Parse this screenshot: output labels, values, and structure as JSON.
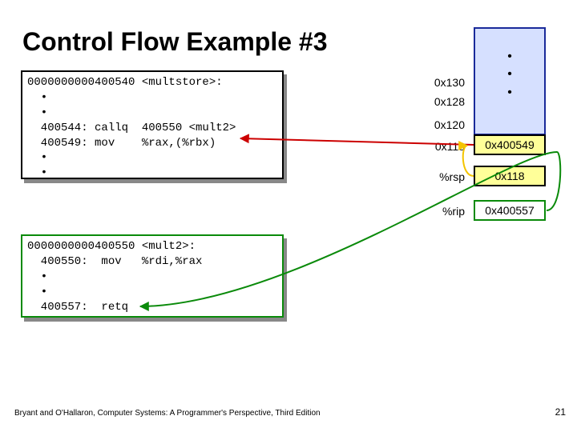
{
  "title": "Control Flow Example #3",
  "code1": "0000000000400540 <multstore>:\n  •\n  •\n  400544: callq  400550 <mult2>\n  400549: mov    %rax,(%rbx)\n  •\n  •",
  "code2": "0000000000400550 <mult2>:\n  400550:  mov   %rdi,%rax\n  •\n  •\n  400557:  retq",
  "stack_dots": "•\n•\n•",
  "addrs": {
    "a130": "0x130",
    "a128": "0x128",
    "a120": "0x120",
    "a118": "0x118"
  },
  "stack_val": "0x400549",
  "regs": {
    "rsp_label": "%rsp",
    "rsp_val": "0x118",
    "rip_label": "%rip",
    "rip_val": "0x400557"
  },
  "footer": "Bryant and O'Hallaron, Computer Systems: A Programmer's Perspective, Third Edition",
  "page": "21"
}
